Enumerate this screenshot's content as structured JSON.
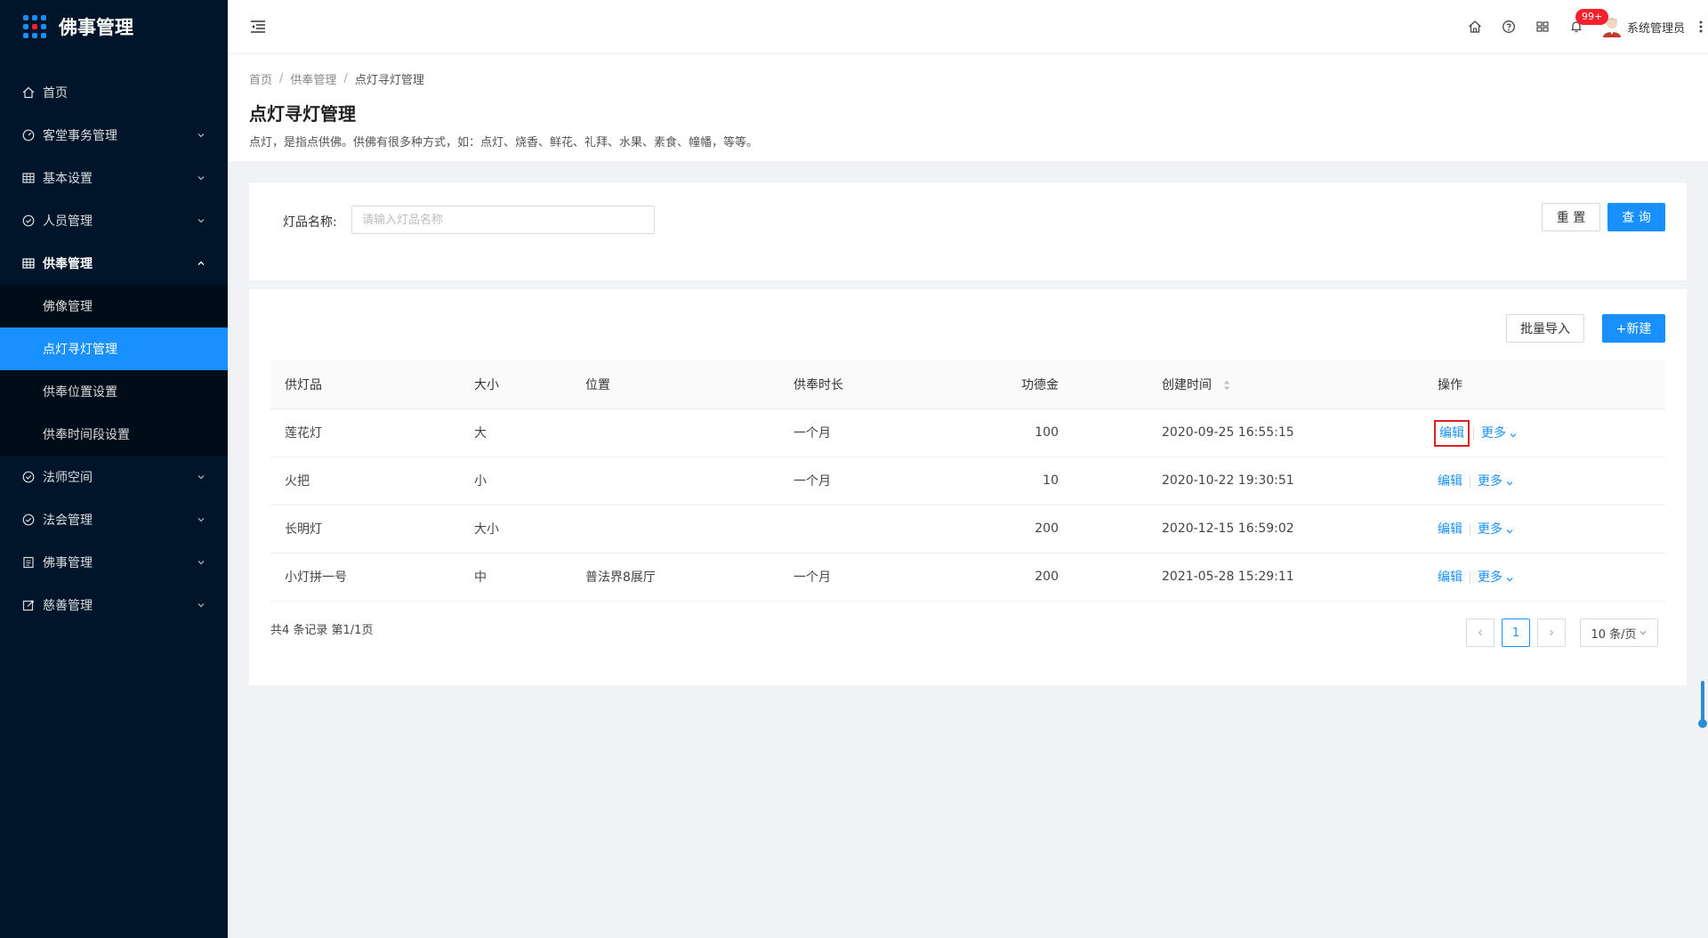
{
  "app": {
    "title": "佛事管理"
  },
  "colors": {
    "accent": "#1890ff",
    "sidebar_bg": "#001529",
    "submenu_bg": "#000c17",
    "danger": "#f5222d",
    "highlight": "#e02020"
  },
  "sidebar": {
    "items": [
      {
        "label": "首页",
        "icon": "home-icon"
      },
      {
        "label": "客堂事务管理",
        "icon": "dashboard-icon"
      },
      {
        "label": "基本设置",
        "icon": "table-icon"
      },
      {
        "label": "人员管理",
        "icon": "check-circle-icon"
      },
      {
        "label": "供奉管理",
        "icon": "table-icon"
      },
      {
        "label": "法师空间",
        "icon": "check-circle-icon"
      },
      {
        "label": "法会管理",
        "icon": "check-circle-icon"
      },
      {
        "label": "佛事管理",
        "icon": "profile-icon"
      },
      {
        "label": "慈善管理",
        "icon": "edit-icon"
      }
    ],
    "submenu": [
      {
        "label": "佛像管理"
      },
      {
        "label": "点灯寻灯管理"
      },
      {
        "label": "供奉位置设置"
      },
      {
        "label": "供奉时间段设置"
      }
    ]
  },
  "header": {
    "badge": "99+",
    "username": "系统管理员",
    "icons": [
      "home-icon",
      "question-icon",
      "appstore-icon",
      "bell-icon"
    ]
  },
  "page": {
    "breadcrumb": [
      "首页",
      "供奉管理",
      "点灯寻灯管理"
    ],
    "title": "点灯寻灯管理",
    "description": "点灯，是指点供佛。供佛有很多种方式，如：点灯、烧香、鲜花、礼拜、水果、素食、幢幡，等等。"
  },
  "search": {
    "label": "灯品名称:",
    "placeholder": "请输入灯品名称",
    "reset_label": "重 置",
    "query_label": "查 询"
  },
  "toolbar": {
    "import_label": "批量导入",
    "new_label": "+新建"
  },
  "table": {
    "columns": [
      "供灯品",
      "大小",
      "位置",
      "供奉时长",
      "功德金",
      "创建时间",
      "操作"
    ],
    "rows": [
      {
        "name": "莲花灯",
        "size": "大",
        "location": "",
        "duration": "一个月",
        "amount": "100",
        "created": "2020-09-25 16:55:15"
      },
      {
        "name": "火把",
        "size": "小",
        "location": "",
        "duration": "一个月",
        "amount": "10",
        "created": "2020-10-22 19:30:51"
      },
      {
        "name": "长明灯",
        "size": "大小",
        "location": "",
        "duration": "",
        "amount": "200",
        "created": "2020-12-15 16:59:02"
      },
      {
        "name": "小灯拼一号",
        "size": "中",
        "location": "普法界8展厅",
        "duration": "一个月",
        "amount": "200",
        "created": "2021-05-28 15:29:11"
      }
    ],
    "edit_label": "编辑",
    "more_label": "更多"
  },
  "pagination": {
    "summary": "共4 条记录 第1/1页",
    "current": "1",
    "page_size": "10 条/页"
  }
}
